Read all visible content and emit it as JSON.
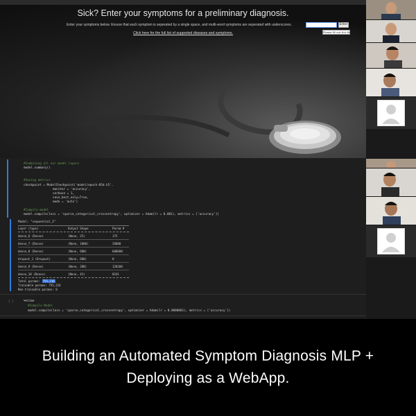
{
  "webapp": {
    "title": "Sick? Enter your symptoms for a preliminary diagnosis.",
    "instructions": "Enter your symptoms below. Ensure that each symptom is seperated by a single space, and multi-word symptoms are seperated with underscores.",
    "input_value": "",
    "enter_label": "Enter",
    "tooltip": "Please fill out this field.",
    "full_list_link": "Click here for the full list of supported diseases and symptoms."
  },
  "notebook": {
    "cell1": {
      "comment_combine": "#Combining all our model layers",
      "summary_call": "model.summary()",
      "comment_save": "#Saving metrics",
      "checkpoint_line": "checkpoint = ModelCheckpoint('model/epoch-05d.h5',",
      "monitor_line": "monitor = 'accuracy',",
      "verbose_line": "verbose = 1,",
      "save_best_line": "save_best_only=True,",
      "mode_line": "mode = 'auto')",
      "comment_compile": "#Compile model",
      "compile_line": "model.compile(loss = 'sparse_categorical_crossentropy', optimizer = Adam(lr = 0.001), metrics = ['accuracy'])"
    },
    "summary": {
      "model_name": "Model: \"sequential_2\"",
      "headers": [
        "Layer (type)",
        "Output Shape",
        "Param #"
      ],
      "rows": [
        [
          "dense_6 (Dense)",
          "(None, 25)",
          "175"
        ],
        [
          "dense_7 (Dense)",
          "(None, 1000)",
          "26000"
        ],
        [
          "dense_8 (Dense)",
          "(None, 600)",
          "600600"
        ],
        [
          "dropout_1 (Dropout)",
          "(None, 600)",
          "0"
        ],
        [
          "dense_9 (Dense)",
          "(None, 200)",
          "120200"
        ],
        [
          "dense_10 (Dense)",
          "(None, 41)",
          "8241"
        ]
      ],
      "total_label": "Total params:",
      "total_value": "755,216",
      "trainable": "Trainable params: 755,216",
      "non_trainable": "Non-trainable params: 0"
    },
    "cell2": {
      "prompt": "[ ]",
      "first_line": "%%time",
      "comment": "#Compile Model",
      "compile_line": "model.compile(loss = 'sparse_categorical_crossentropy', optimizer = Adam(lr = 0.0000001), metrics = ['accuracy'])"
    }
  },
  "caption": {
    "line1": "Building an Automated Symptom Diagnosis MLP +",
    "line2": "Deploying as a WebApp."
  },
  "colors": {
    "cell_accent": "#2f7fd6",
    "highlight": "#2e6fd8",
    "code_comment": "#6a9955",
    "code_string": "#ce9178"
  }
}
